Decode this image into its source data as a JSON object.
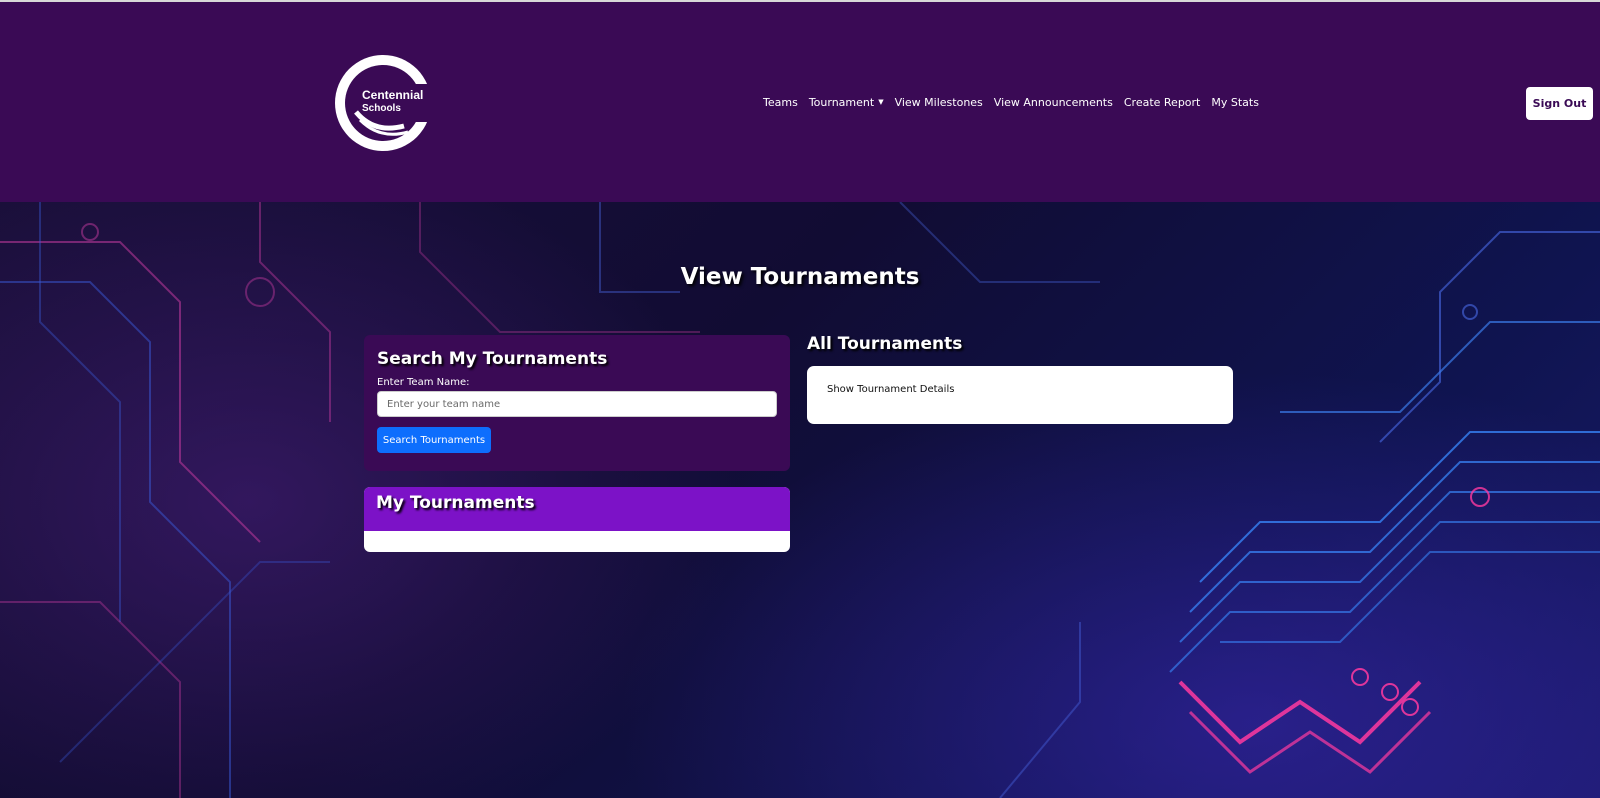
{
  "navbar": {
    "logo_text_line1": "Centennial",
    "logo_text_line2": "Schools",
    "links": [
      "Teams",
      "Tournament",
      "View Milestones",
      "View Announcements",
      "Create Report",
      "My Stats"
    ],
    "sign_out_label": "Sign Out",
    "background_color": "#3a0a55"
  },
  "main": {
    "page_title": "View Tournaments",
    "search_card": {
      "title": "Search My Tournaments",
      "field_label": "Enter Team Name:",
      "input_placeholder": "Enter your team name",
      "input_value": "",
      "button_label": "Search Tournaments"
    },
    "my_tournaments": {
      "title": "My Tournaments"
    },
    "all_tournaments": {
      "title": "All Tournaments",
      "details_text": "Show Tournament Details"
    }
  },
  "colors": {
    "primary_purple": "#3a0a55",
    "accent_purple": "#7c12c7",
    "button_blue": "#0d6efd"
  }
}
